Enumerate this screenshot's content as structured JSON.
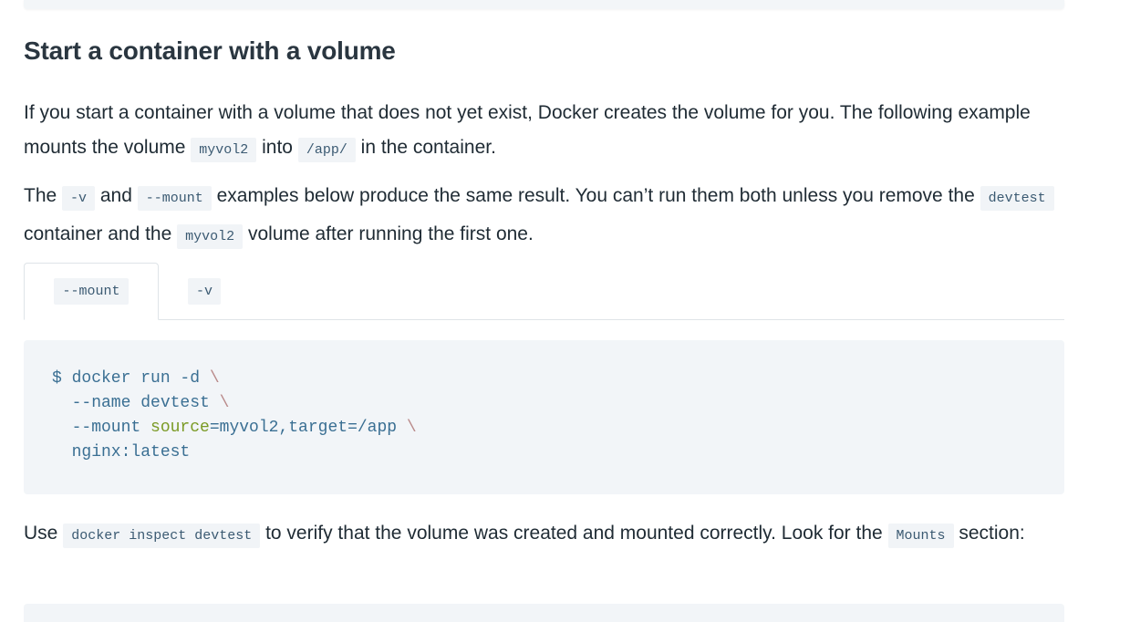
{
  "heading": "Start a container with a volume",
  "para1": {
    "text_a": "If you start a container with a volume that does not yet exist, Docker creates the volume for you. The following example mounts the volume ",
    "code_a": "myvol2",
    "text_b": " into ",
    "code_b": "/app/",
    "text_c": " in the container."
  },
  "para2": {
    "text_a": "The ",
    "code_a": "-v",
    "text_b": " and ",
    "code_b": "--mount",
    "text_c": " examples below produce the same result. You can’t run them both unless you remove the ",
    "code_c": "devtest",
    "text_d": " container and the ",
    "code_d": "myvol2",
    "text_e": " volume after running the first one."
  },
  "tabs": [
    {
      "label": "--mount",
      "active": true
    },
    {
      "label": "-v",
      "active": false
    }
  ],
  "code": {
    "line1_prompt": "$ docker run -d",
    "line2_text": "  --name devtest",
    "line3_flag": "  --mount ",
    "line3_key": "source",
    "line3_rest": "=myvol2,target=/app",
    "line4_text": "  nginx:latest",
    "continuation": "\\"
  },
  "para3": {
    "text_a": "Use ",
    "code_a": "docker inspect devtest",
    "text_b": " to verify that the volume was created and mounted correctly. Look for the ",
    "code_b": "Mounts",
    "text_c": " section:"
  }
}
